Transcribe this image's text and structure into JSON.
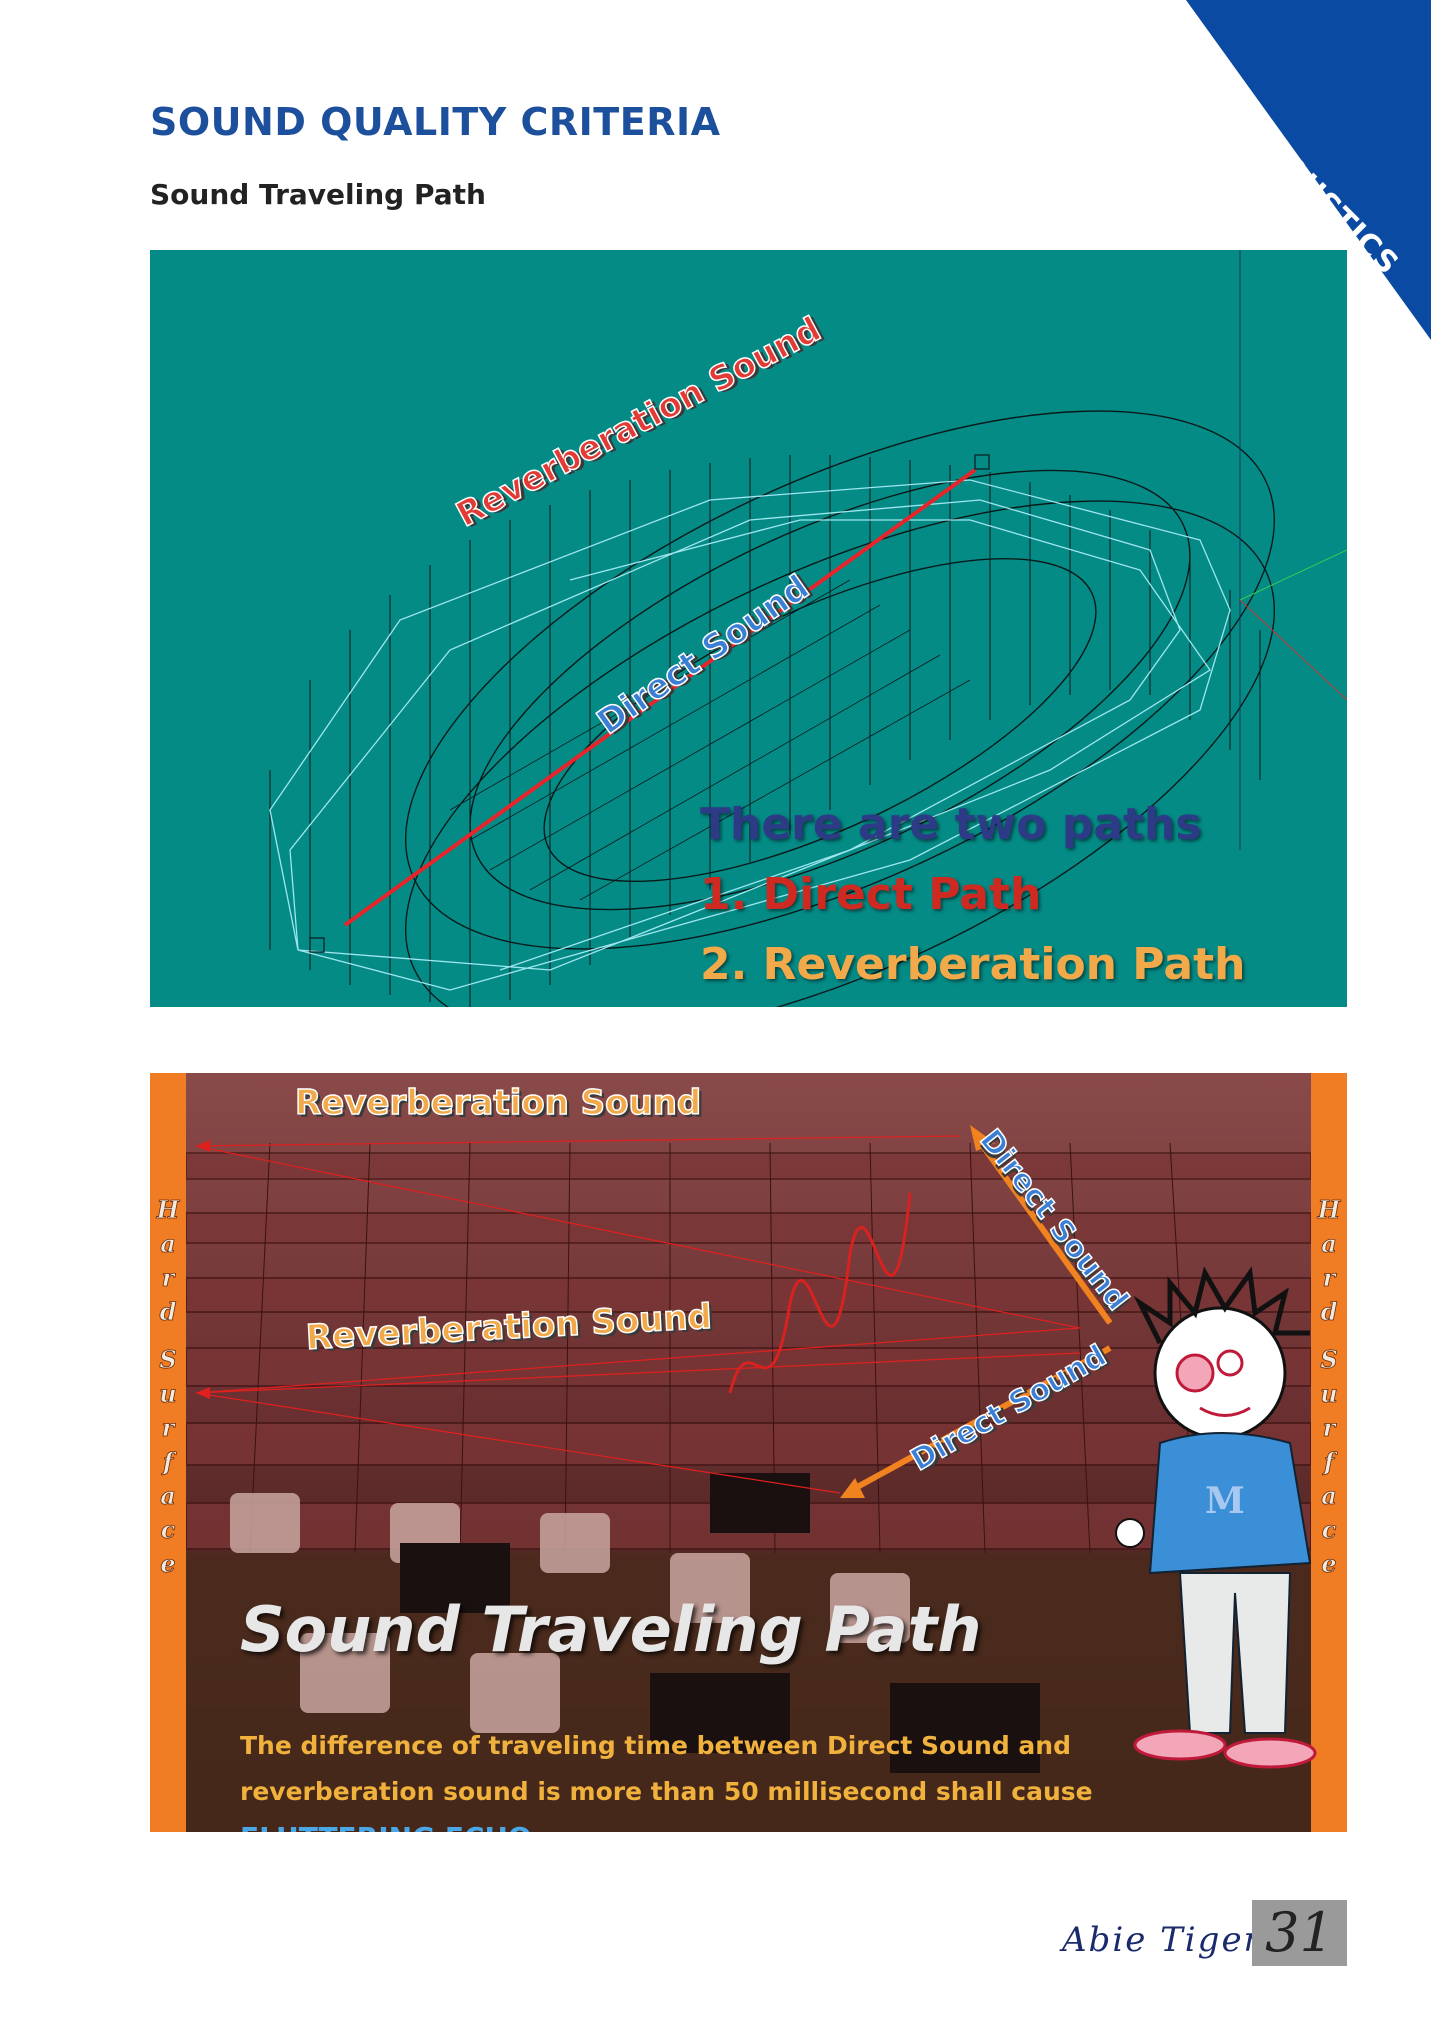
{
  "corner_tab": {
    "label": "BASIC ACOUSTICS",
    "color": "#0b4aa2"
  },
  "header": {
    "title": "SOUND QUALITY CRITERIA",
    "subtitle": "Sound Traveling Path"
  },
  "figure1": {
    "labels": {
      "reverberation": "Reverberation Sound",
      "direct": "Direct Sound"
    },
    "paths": {
      "heading": "There are two paths",
      "item1": "1.  Direct Path",
      "item2": "2.  Reverberation Path"
    },
    "colors": {
      "background": "#048b86",
      "direct_line": "#e8242b",
      "reverb_lines": "#9fe6ee"
    }
  },
  "figure2": {
    "labels": {
      "reverberation_top": "Reverberation Sound",
      "reverberation_mid": "Reverberation Sound",
      "direct_upper": "Direct Sound",
      "direct_lower": "Direct Sound"
    },
    "side_text_left": "Hard Surface",
    "side_text_right": "Hard Surface",
    "side_letters": [
      "H",
      "a",
      "r",
      "d",
      "S",
      "u",
      "r",
      "f",
      "a",
      "c",
      "e"
    ],
    "caption": "Sound Traveling Path",
    "note_text": "The difference of traveling time between Direct Sound and reverberation sound is more than 50 millisecond shall cause",
    "note_highlight": "FLUTTERING ECHO.",
    "colors": {
      "side_bar": "#f07c24",
      "highlight": "#4aa8e8",
      "note": "#f0b23c"
    }
  },
  "footer": {
    "signature": "Abie Tiger",
    "page_number": "31"
  }
}
